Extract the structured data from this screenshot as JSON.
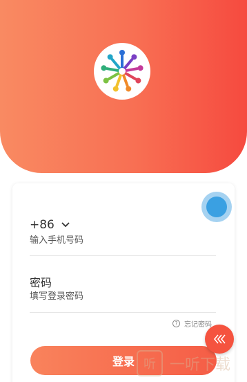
{
  "login_form": {
    "country_code": "+86",
    "phone_placeholder": "输入手机号码",
    "password_label": "密码",
    "password_placeholder": "填写登录密码",
    "forgot_password": "忘记密码"
  },
  "login_button": "登录",
  "watermark": {
    "icon_text": "听",
    "text": "一听下载"
  },
  "icons": {
    "logo": "people-circle-logo",
    "chevron": "chevron-down-icon",
    "help": "question-circle-icon",
    "side": "chevrons-left-icon",
    "assistive": "floating-assistive-touch"
  },
  "colors": {
    "accent_start": "#f98a62",
    "accent_end": "#f64a3f",
    "assistive_blue": "#3aa0e2"
  }
}
